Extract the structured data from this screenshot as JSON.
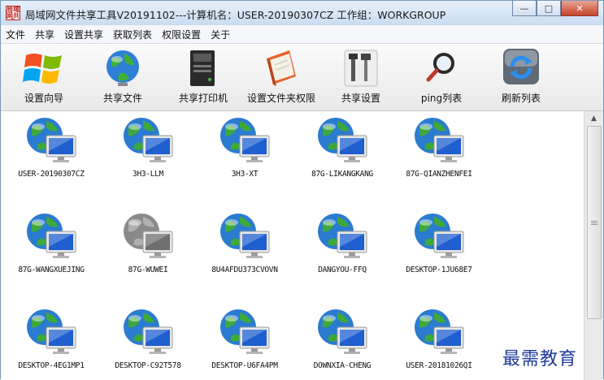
{
  "window": {
    "title": "局域网文件共享工具V20191102---计算机名：USER-20190307CZ 工作组：WORKGROUP",
    "app_icon_text": "局域网共享",
    "controls": {
      "minimize": "—",
      "maximize": "□",
      "close": "✕"
    }
  },
  "menu": [
    "文件",
    "共享",
    "设置共享",
    "获取列表",
    "权限设置",
    "关于"
  ],
  "toolbar": [
    {
      "label": "设置向导",
      "icon": "windows-logo-icon"
    },
    {
      "label": "共享文件",
      "icon": "globe-icon"
    },
    {
      "label": "共享打印机",
      "icon": "printer-icon"
    },
    {
      "label": "设置文件夹权限",
      "icon": "folder-book-icon"
    },
    {
      "label": "共享设置",
      "icon": "tools-icon"
    },
    {
      "label": "ping列表",
      "icon": "magnifier-icon"
    },
    {
      "label": "刷新列表",
      "icon": "refresh-icon"
    }
  ],
  "hosts": [
    {
      "name": "USER-20190307CZ",
      "online": true
    },
    {
      "name": "3H3-LLM",
      "online": true
    },
    {
      "name": "3H3-XT",
      "online": true
    },
    {
      "name": "87G-LIKANGKANG",
      "online": true
    },
    {
      "name": "87G-QIANZHENFEI",
      "online": true
    },
    {
      "name": "87G-WANGXUEJING",
      "online": true
    },
    {
      "name": "87G-WUWEI",
      "online": false
    },
    {
      "name": "8U4AFDU373CVOVN",
      "online": true
    },
    {
      "name": "DANGYOU-FFQ",
      "online": true
    },
    {
      "name": "DESKTOP-1JU68E7",
      "online": true
    },
    {
      "name": "DESKTOP-4EG1MP1",
      "online": true
    },
    {
      "name": "DESKTOP-C92T578",
      "online": true
    },
    {
      "name": "DESKTOP-U6FA4PM",
      "online": true
    },
    {
      "name": "DOWNXIA-CHENG",
      "online": true
    },
    {
      "name": "USER-20181026QI",
      "online": true
    }
  ],
  "watermark": "最需教育",
  "scrollbar": {
    "up_arrow": "▲"
  },
  "colors": {
    "accent": "#1e3a9a",
    "close": "#c7452b"
  }
}
